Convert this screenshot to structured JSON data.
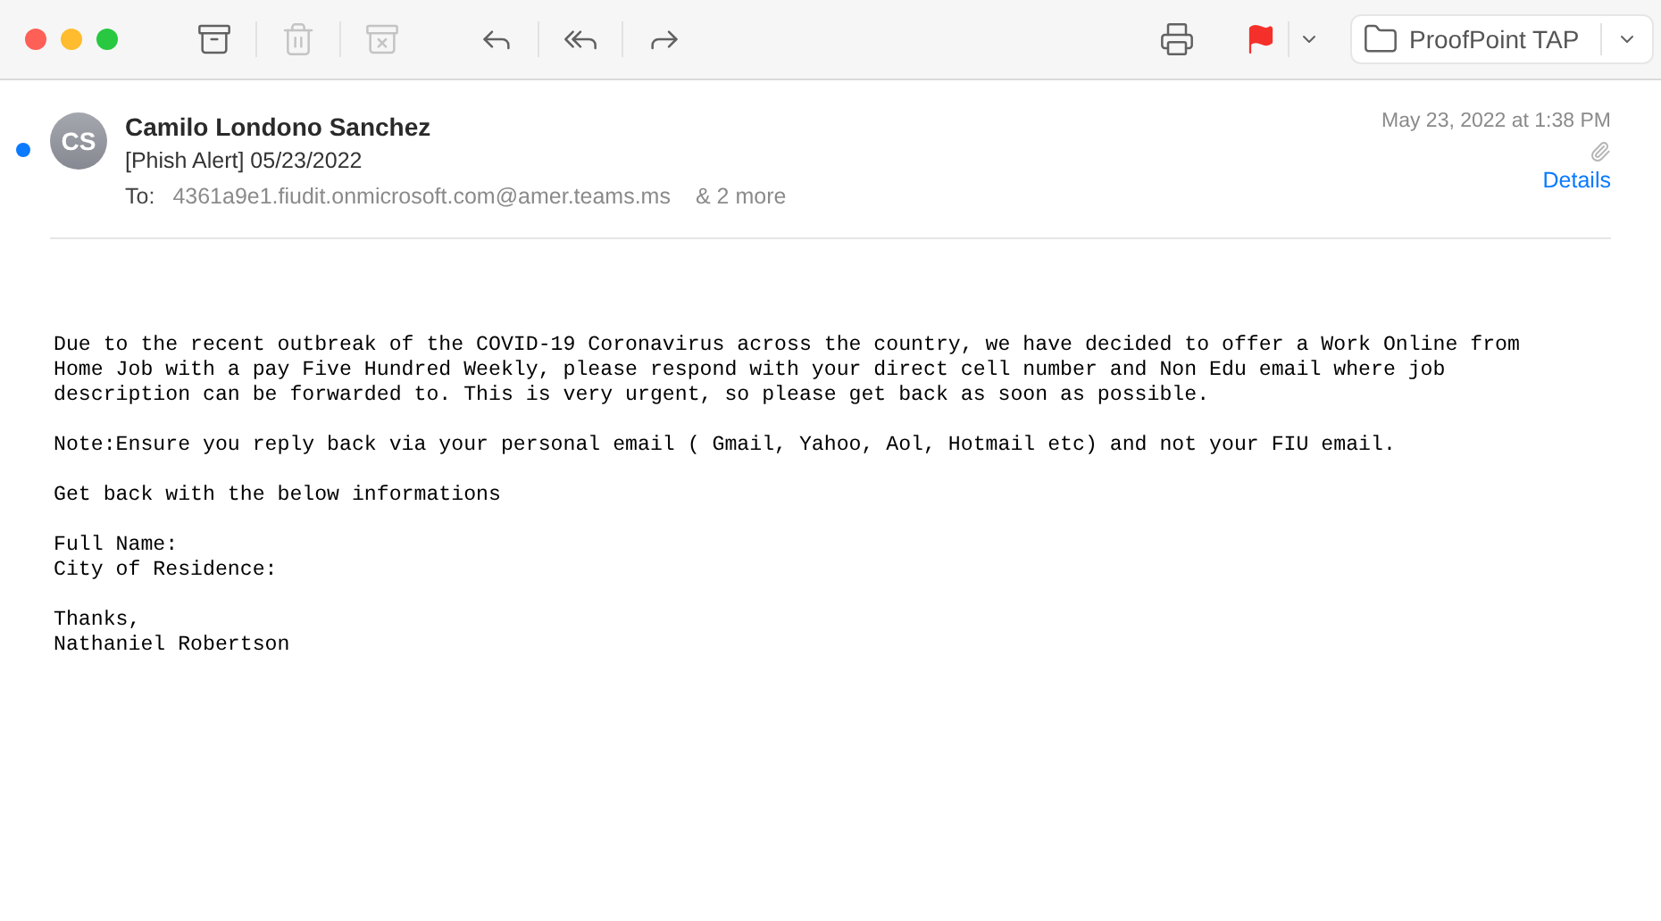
{
  "toolbar": {
    "left": [
      {
        "kind": "archive",
        "disabled": false
      },
      {
        "kind": "trash",
        "disabled": true
      },
      {
        "kind": "junk",
        "disabled": true
      },
      {
        "kind": "reply",
        "disabled": false
      },
      {
        "kind": "reply-all",
        "disabled": false
      },
      {
        "kind": "forward",
        "disabled": false
      }
    ],
    "flagged": true,
    "mailbox": "ProofPoint TAP"
  },
  "message": {
    "unread": true,
    "initials": "CS",
    "sender": "Camilo Londono Sanchez",
    "subject": "[Phish Alert] 05/23/2022",
    "to_label": "To:",
    "to": "4361a9e1.fiudit.onmicrosoft.com@amer.teams.ms",
    "more": "& 2 more",
    "date": "May 23, 2022 at 1:38 PM",
    "has_attachment": true,
    "details": "Details",
    "body": [
      "Due to the recent outbreak of the COVID-19 Coronavirus across the country, we have decided to offer a Work Online from\nHome Job with a pay Five Hundred Weekly, please respond with your direct cell number and Non Edu email where job\ndescription can be forwarded to. This is very urgent, so please get back as soon as possible.",
      "Note:Ensure you reply back via your personal email ( Gmail, Yahoo, Aol, Hotmail etc) and not your FIU email.",
      "Get back with the below informations",
      "Full Name:\nCity of Residence:",
      "Thanks,\nNathaniel Robertson"
    ]
  }
}
